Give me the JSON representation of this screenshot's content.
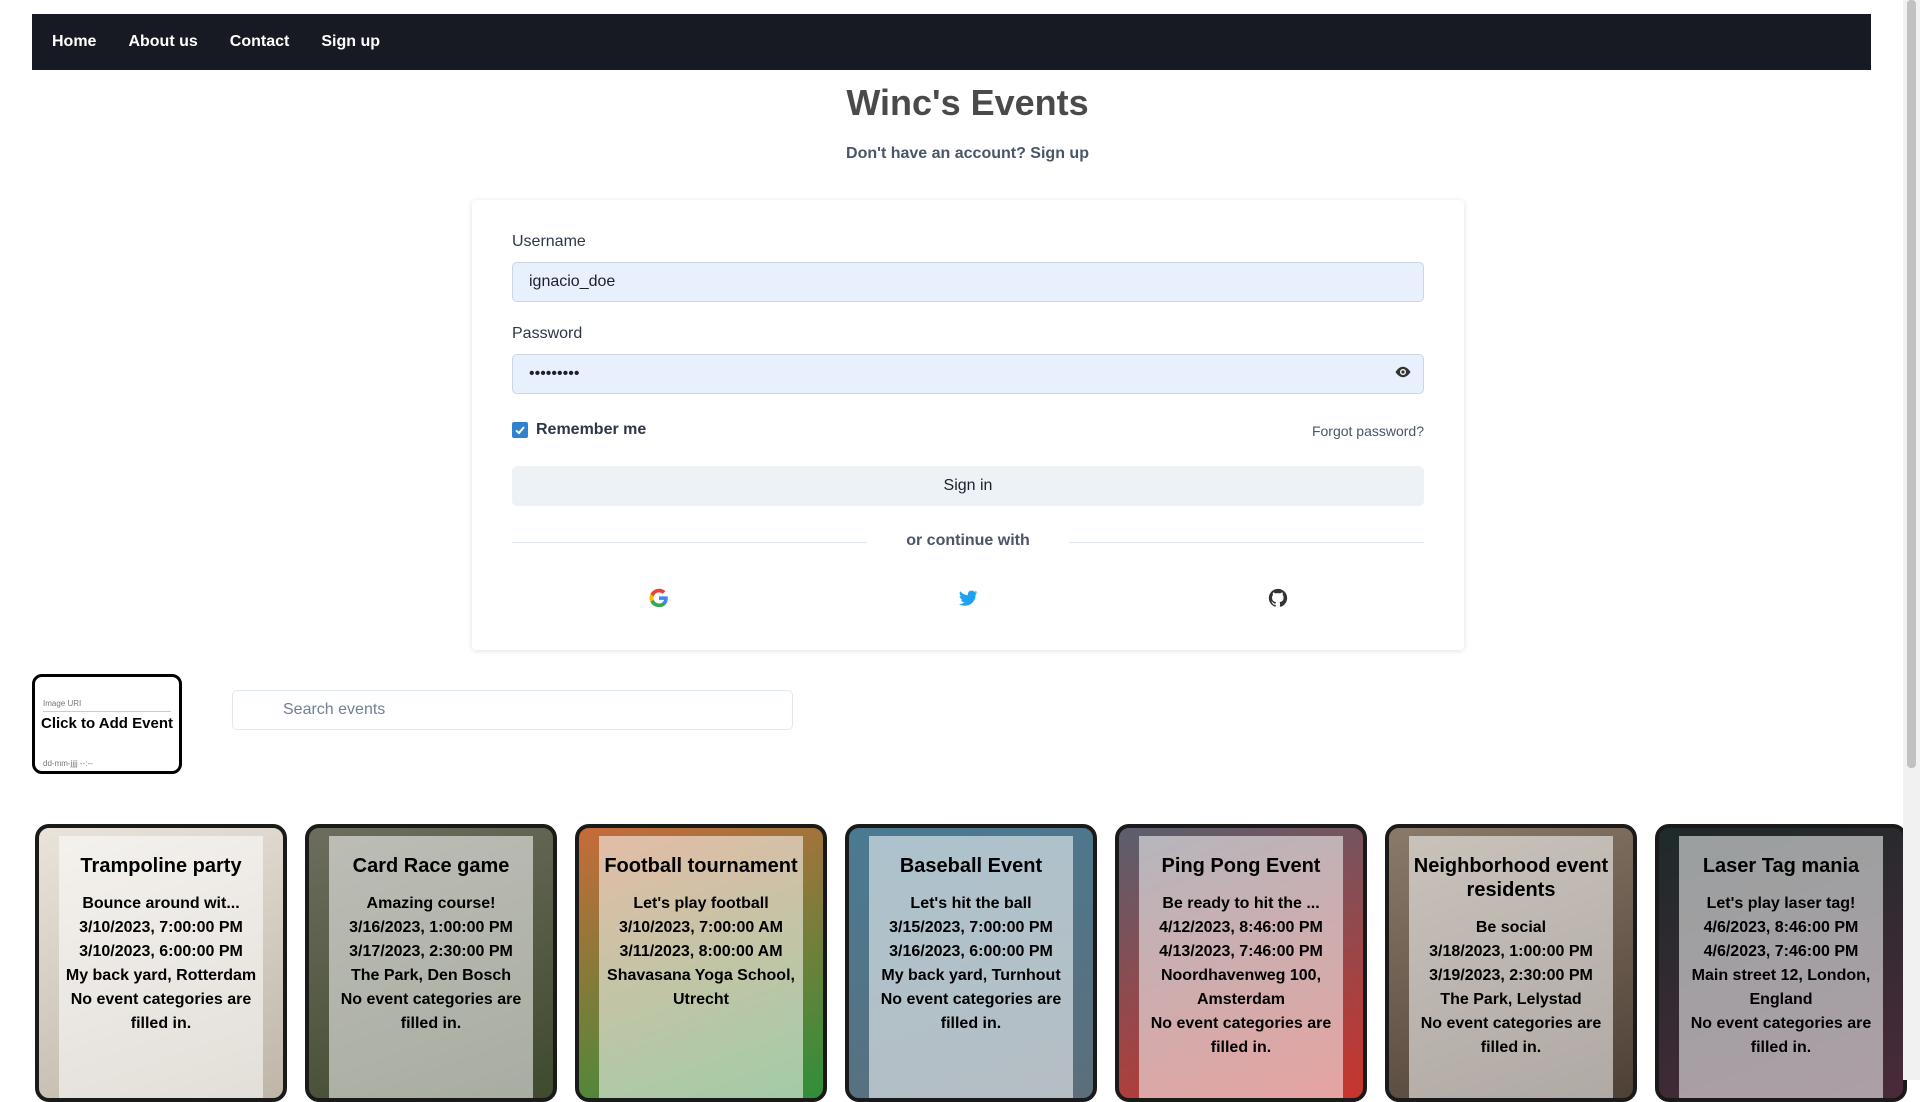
{
  "nav": {
    "items": [
      {
        "label": "Home"
      },
      {
        "label": "About us"
      },
      {
        "label": "Contact"
      },
      {
        "label": "Sign up"
      }
    ]
  },
  "header": {
    "title": "Winc's Events",
    "signup_prompt": "Don't have an account? Sign up"
  },
  "login": {
    "username_label": "Username",
    "username_value": "ignacio_doe",
    "password_label": "Password",
    "password_value": "•••••••••",
    "remember_label": "Remember me",
    "remember_checked": true,
    "forgot_label": "Forgot password?",
    "signin_label": "Sign in",
    "divider_text": "or continue with",
    "providers": [
      {
        "icon": "google-icon"
      },
      {
        "icon": "twitter-icon"
      },
      {
        "icon": "github-icon"
      }
    ]
  },
  "add_event": {
    "label": "Click to Add Event",
    "ghost_image_uri": "Image URI",
    "ghost_date": "dd-mm-jjjj --:--"
  },
  "search": {
    "placeholder": "Search events"
  },
  "events": [
    {
      "title": "Trampoline party",
      "lines": [
        "Bounce around wit...",
        "3/10/2023, 7:00:00 PM",
        "3/10/2023, 6:00:00 PM",
        "My back yard, Rotterdam",
        "No event categories are filled in."
      ],
      "bg": [
        "#e9e3da",
        "#bfb6a8"
      ]
    },
    {
      "title": "Card Race game",
      "lines": [
        "Amazing course!",
        "3/16/2023, 1:00:00 PM",
        "3/17/2023, 2:30:00 PM",
        "The Park, Den Bosch",
        "No event categories are filled in."
      ],
      "bg": [
        "#6d6d5e",
        "#3f4a2e"
      ]
    },
    {
      "title": "Football tournament",
      "lines": [
        "Let's play football",
        "3/10/2023, 7:00:00 AM",
        "3/11/2023, 8:00:00 AM",
        "Shavasana Yoga School, Utrecht"
      ],
      "bg": [
        "#c76b3a",
        "#2f8f3a"
      ]
    },
    {
      "title": "Baseball Event",
      "lines": [
        "Let's hit the ball",
        "3/15/2023, 7:00:00 PM",
        "3/16/2023, 6:00:00 PM",
        "My back yard, Turnhout",
        "No event categories are filled in."
      ],
      "bg": [
        "#4a7a93",
        "#5c6e7a"
      ]
    },
    {
      "title": "Ping Pong Event",
      "lines": [
        "Be ready to hit the ...",
        "4/12/2023, 8:46:00 PM",
        "4/13/2023, 7:46:00 PM",
        "Noordhavenweg 100, Amsterdam",
        "No event categories are filled in."
      ],
      "bg": [
        "#5a5f6e",
        "#c9342d"
      ]
    },
    {
      "title": "Neighborhood event residents",
      "lines": [
        "Be social",
        "3/18/2023, 1:00:00 PM",
        "3/19/2023, 2:30:00 PM",
        "The Park, Lelystad",
        "No event categories are filled in."
      ],
      "bg": [
        "#8a7a6a",
        "#4f4036"
      ]
    },
    {
      "title": "Laser Tag mania",
      "lines": [
        "Let's play laser tag!",
        "4/6/2023, 8:46:00 PM",
        "4/6/2023, 7:46:00 PM",
        "Main street 12, London, England",
        "No event categories are filled in."
      ],
      "bg": [
        "#1e2a2a",
        "#4a2a3a"
      ]
    }
  ]
}
